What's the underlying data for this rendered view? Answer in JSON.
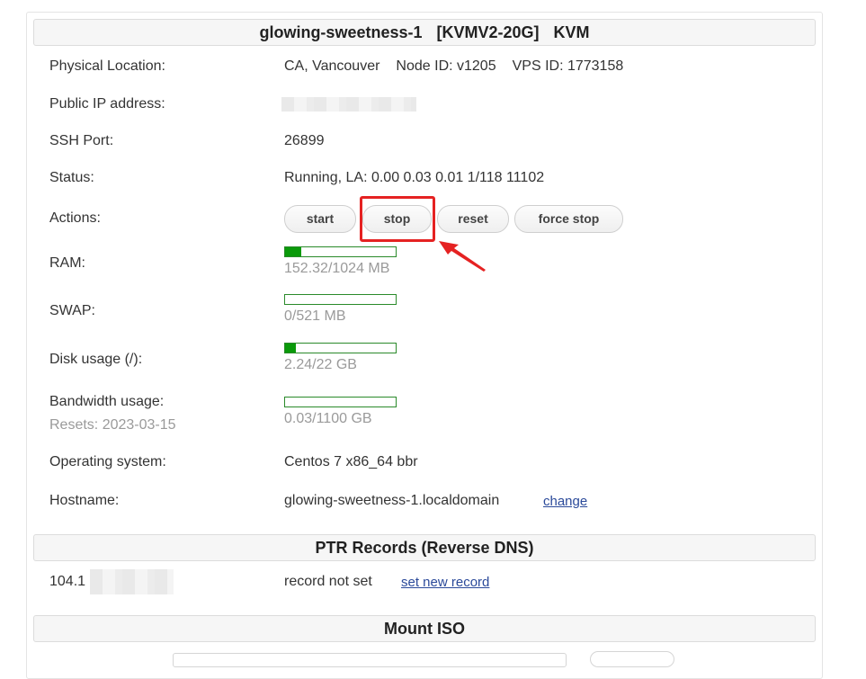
{
  "vps_header": {
    "hostname": "glowing-sweetness-1",
    "plan": "[KVMV2-20G]",
    "virt": "KVM"
  },
  "rows": {
    "location": {
      "label": "Physical Location:",
      "value": "CA, Vancouver",
      "node": "Node ID: v1205",
      "vps": "VPS ID: 1773158"
    },
    "public_ip": {
      "label": "Public IP address:"
    },
    "ssh": {
      "label": "SSH Port:",
      "value": "26899"
    },
    "status": {
      "label": "Status:",
      "value": "Running, LA: 0.00 0.03 0.01 1/118 11102"
    },
    "actions": {
      "label": "Actions:"
    },
    "ram": {
      "label": "RAM:",
      "text": "152.32/1024 MB",
      "fraction": 0.149
    },
    "swap": {
      "label": "SWAP:",
      "text": "0/521 MB",
      "fraction": 0.0
    },
    "disk": {
      "label": "Disk usage (/):",
      "text": "2.24/22 GB",
      "fraction": 0.1
    },
    "bandwidth": {
      "label": "Bandwidth usage:",
      "resets": "Resets: 2023-03-15",
      "text": "0.03/1100 GB",
      "fraction": 0.0
    },
    "os": {
      "label": "Operating system:",
      "value": "Centos 7 x86_64 bbr"
    },
    "hostname": {
      "label": "Hostname:",
      "value": "glowing-sweetness-1.localdomain",
      "change": "change"
    }
  },
  "actions": {
    "start": "start",
    "stop": "stop",
    "reset": "reset",
    "force_stop": "force stop"
  },
  "ptr": {
    "title": "PTR Records (Reverse DNS)",
    "ip_prefix": "104.1",
    "status": "record not set",
    "set_link": "set new record"
  },
  "mount_iso": {
    "title": "Mount ISO"
  },
  "colors": {
    "bar_fill": "#0a9a0a",
    "bar_border": "#2a8a2a",
    "highlight": "#e52222",
    "link": "#2b4a9a"
  }
}
